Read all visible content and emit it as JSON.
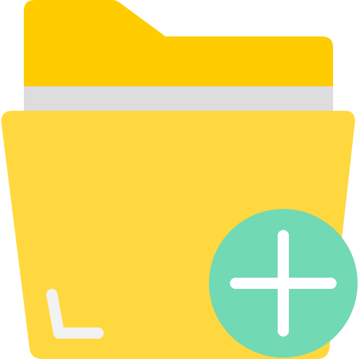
{
  "icon": {
    "name": "add-folder-icon",
    "colors": {
      "folder_back": "#FFCC00",
      "folder_front": "#FFD83F",
      "paper": "#DDDDE0",
      "corner_mark": "#F2F2F2",
      "badge": "#71D9B4",
      "badge_plus": "#FFFFFF"
    }
  }
}
